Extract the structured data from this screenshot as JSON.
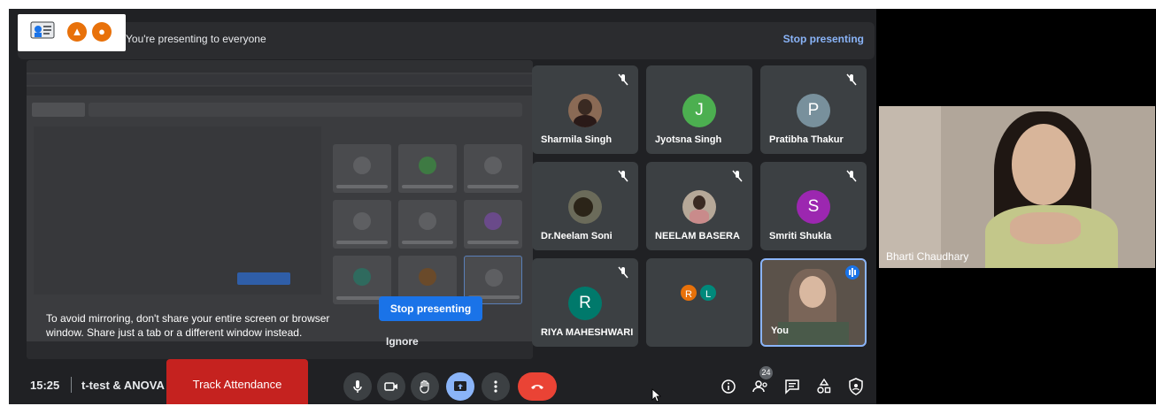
{
  "banner": {
    "text": "You're presenting to everyone",
    "stop_label": "Stop presenting"
  },
  "mirror": {
    "warning": "To avoid mirroring, don't share your entire screen or browser window. Share just a tab or a different window instead.",
    "stop_label": "Stop presenting",
    "ignore_label": "Ignore"
  },
  "participants": [
    {
      "name": "Sharmila Singh",
      "avatar": "photo",
      "muted": true
    },
    {
      "name": "Jyotsna Singh",
      "avatar": "J",
      "color": "#4caf50",
      "muted": false
    },
    {
      "name": "Pratibha Thakur",
      "avatar": "P",
      "color": "#78909c",
      "muted": true
    },
    {
      "name": "Dr.Neelam Soni",
      "avatar": "photo",
      "muted": true
    },
    {
      "name": "NEELAM BASERA",
      "avatar": "photo",
      "muted": true
    },
    {
      "name": "Smriti Shukla",
      "avatar": "S",
      "color": "#9c27b0",
      "muted": true
    },
    {
      "name": "RIYA MAHESHWARI",
      "avatar": "R",
      "color": "#00796b",
      "muted": true
    },
    {
      "name": "",
      "avatar_group": [
        "R",
        "L"
      ],
      "colors": [
        "#e8710a",
        "#00897b"
      ]
    },
    {
      "name": "You",
      "self": true
    }
  ],
  "featured": {
    "name": "Bharti Chaudhary"
  },
  "bottom_bar": {
    "time": "15:25",
    "meeting_title": "t-test & ANOVA ...",
    "track_label": "Track Attendance",
    "people_count": "24"
  },
  "colors": {
    "accent": "#8ab4f8",
    "end_call": "#ea4335",
    "track_button": "#c5221f",
    "background": "#202124"
  }
}
